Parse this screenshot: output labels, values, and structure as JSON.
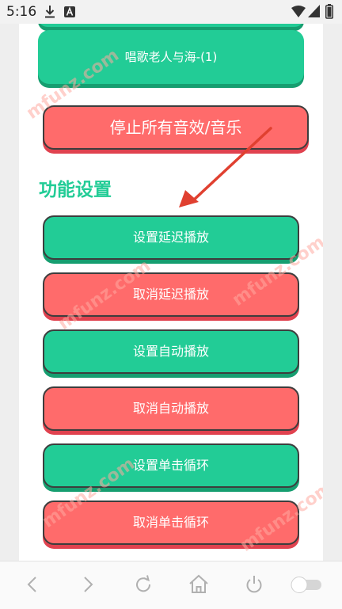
{
  "status_bar": {
    "time": "5:16",
    "icons": [
      "download-icon",
      "a-notification-icon",
      "wifi-icon",
      "signal-icon",
      "battery-icon"
    ]
  },
  "main": {
    "top_song_button": "唱歌老人与海-(1)",
    "stop_all_button": "停止所有音效/音乐",
    "section_title": "功能设置",
    "buttons": [
      {
        "label": "设置延迟播放",
        "color": "green"
      },
      {
        "label": "取消延迟播放",
        "color": "red"
      },
      {
        "label": "设置自动播放",
        "color": "green"
      },
      {
        "label": "取消自动播放",
        "color": "red"
      },
      {
        "label": "设置单击循环",
        "color": "green"
      },
      {
        "label": "取消单击循环",
        "color": "red"
      }
    ]
  },
  "annotation": {
    "arrow_color": "#e04030"
  },
  "watermark": "mfunz.com",
  "nav_bar": {
    "buttons": [
      "back-icon",
      "forward-icon",
      "refresh-icon",
      "home-icon",
      "power-icon",
      "toggle-switch"
    ]
  },
  "colors": {
    "green": "#22cc96",
    "red": "#ff6b6b",
    "title_green": "#22cc96"
  }
}
